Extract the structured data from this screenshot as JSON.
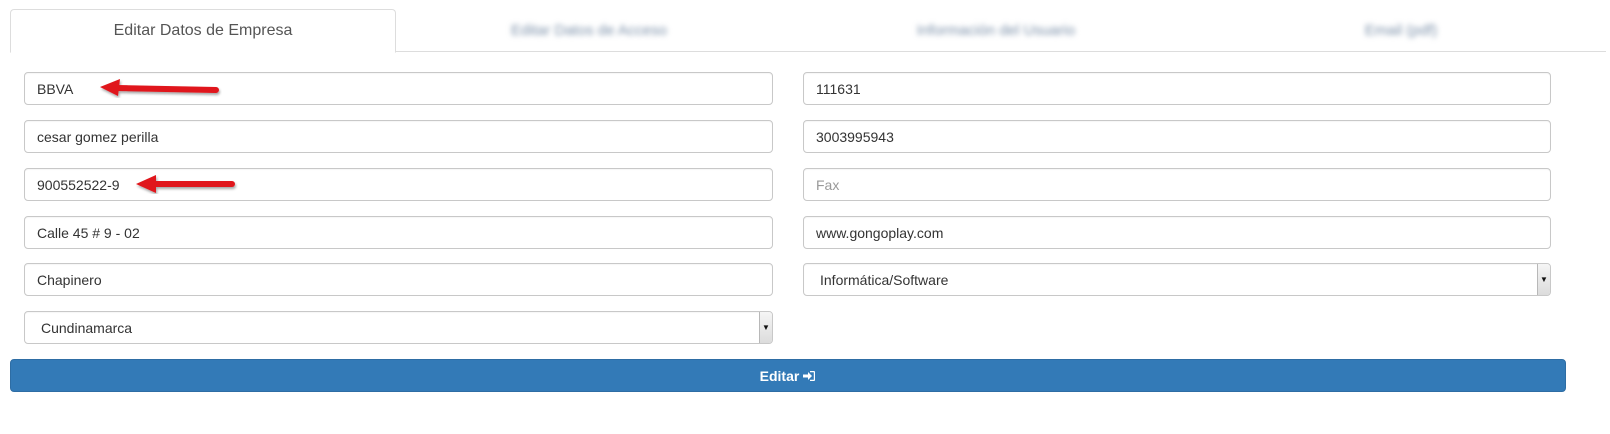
{
  "tabs": [
    {
      "label": "Editar Datos de Empresa",
      "active": true
    },
    {
      "label": "Editar Datos de Acceso",
      "active": false
    },
    {
      "label": "Información del Usuario",
      "active": false
    },
    {
      "label": "Email (pdf)",
      "active": false
    }
  ],
  "form": {
    "left": {
      "bank": "BBVA",
      "contact_name": "cesar gomez perilla",
      "nit": "900552522-9",
      "address": "Calle 45 # 9 - 02",
      "neighborhood": "Chapinero",
      "department": "Cundinamarca"
    },
    "right": {
      "code": "111631",
      "phone": "3003995943",
      "fax_placeholder": "Fax",
      "website": "www.gongoplay.com",
      "sector": "Informática/Software"
    }
  },
  "submit": {
    "label": "Editar",
    "icon": "sign-in-icon"
  },
  "colors": {
    "primary": "#337ab7",
    "arrow": "#e0141a"
  }
}
